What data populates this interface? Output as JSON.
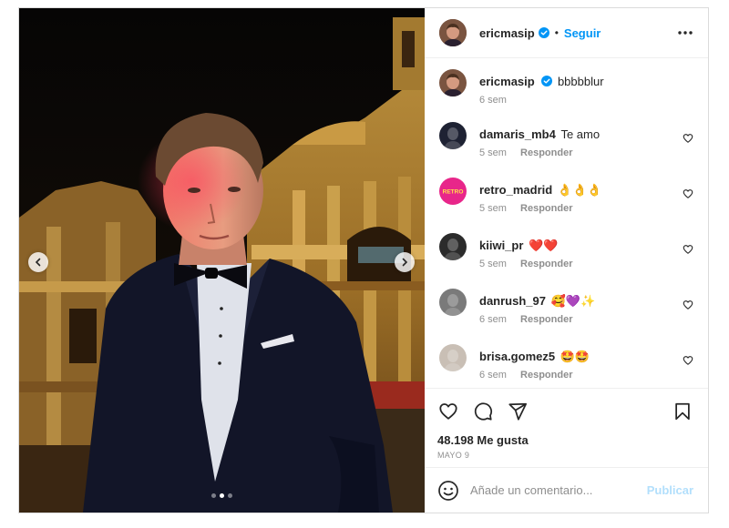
{
  "post": {
    "author": "ericmasip",
    "follow_label": "Seguir",
    "separator": "•",
    "caption_text": "bbbbblur",
    "caption_time": "6 sem",
    "likes": "48.198 Me gusta",
    "date": "MAYO 9",
    "carousel": {
      "total": 3,
      "active_index": 1
    }
  },
  "comments": [
    {
      "user": "damaris_mb4",
      "text": "Te amo",
      "time": "5 sem",
      "reply": "Responder",
      "avatar_color": "#1e2233"
    },
    {
      "user": "retro_madrid",
      "text": "👌👌👌",
      "time": "5 sem",
      "reply": "Responder",
      "avatar_color": "#e8268a",
      "avatar_text": "RETRO"
    },
    {
      "user": "kiiwi_pr",
      "text": "❤️❤️",
      "time": "5 sem",
      "reply": "Responder",
      "avatar_color": "#2b2b2b"
    },
    {
      "user": "danrush_97",
      "text": "🥰💜✨",
      "time": "6 sem",
      "reply": "Responder",
      "avatar_color": "#7a7a7a"
    },
    {
      "user": "brisa.gomez5",
      "text": "🤩🤩",
      "time": "6 sem",
      "reply": "Responder",
      "avatar_color": "#c9bfb5"
    }
  ],
  "composer": {
    "placeholder": "Añade un comentario...",
    "publish_label": "Publicar"
  },
  "colors": {
    "accent": "#0095f6",
    "publish_disabled": "#b2dffc",
    "muted": "#8e8e8e",
    "text": "#262626"
  },
  "icons": {
    "header_more": "more-dots-icon",
    "actions": [
      "heart-icon",
      "comment-icon",
      "share-icon",
      "bookmark-icon"
    ],
    "composer": "emoji-icon"
  }
}
